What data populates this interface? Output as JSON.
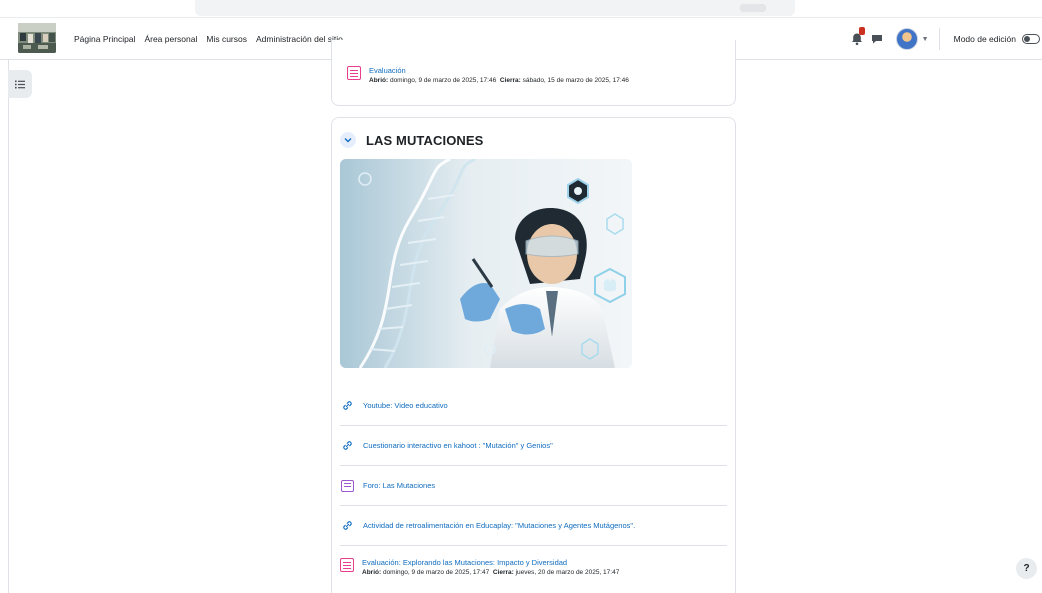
{
  "nav": {
    "links": [
      "Página Principal",
      "Área personal",
      "Mis cursos",
      "Administración del sitio"
    ],
    "edit_mode_label": "Modo de edición"
  },
  "prev_activity": {
    "name": "Evaluación",
    "opened_label": "Abrió:",
    "opened_date": "domingo, 9 de marzo de 2025, 17:46",
    "closes_label": "Cierra:",
    "closes_date": "sábado, 15 de marzo de 2025, 17:46"
  },
  "section": {
    "title": "LAS MUTACIONES",
    "activities": [
      {
        "icon": "url-icon",
        "name": "Youtube: Video educativo"
      },
      {
        "icon": "url-icon",
        "name": "Cuestionario interactivo en kahoot : \"Mutación\" y Genios\""
      },
      {
        "icon": "forum-icon",
        "name": "Foro: Las Mutaciones"
      },
      {
        "icon": "url-icon",
        "name": "Actividad de retroalimentación en Educaplay: \"Mutaciones y Agentes Mutágenos\"."
      }
    ],
    "last_activity": {
      "icon": "quiz-icon",
      "name": "Evaluación: Explorando las Mutaciones: Impacto y Diversidad",
      "opened_label": "Abrió:",
      "opened_date": "domingo, 9 de marzo de 2025, 17:47",
      "closes_label": "Cierra:",
      "closes_date": "jueves, 20 de marzo de 2025, 17:47"
    }
  },
  "help_label": "?",
  "colors": {
    "link": "#0f6cbf",
    "quiz": "#e83e8c",
    "forum": "#9b59d0",
    "badge": "#ca3120"
  }
}
